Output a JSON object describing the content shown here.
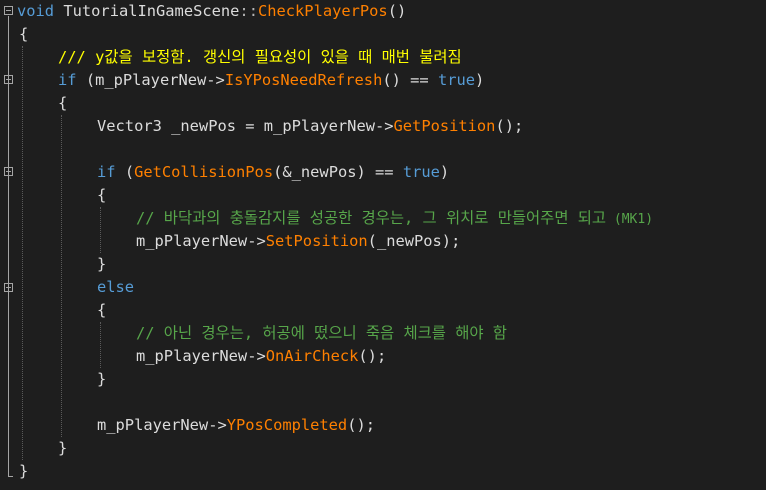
{
  "colors": {
    "background": "#1e1e1e",
    "keyword": "#569cd6",
    "function": "#ff8000",
    "plain": "#dcdcdc",
    "comment": "#57a64a",
    "doc_comment": "#ffff00",
    "fold_marker": "#a5a5a5"
  },
  "lines": {
    "l1": {
      "kw": "void",
      "name": "TutorialInGameScene",
      "sep": "::",
      "fn": "CheckPlayerPos",
      "tail": "()"
    },
    "l2": {
      "text": "{"
    },
    "l3": {
      "slashes": "///",
      "text": "y값을 보정함. 갱신의 필요성이 있을 때 매번 불려짐"
    },
    "l4": {
      "kw": "if",
      "pre": " (m_pPlayerNew->",
      "fn": "IsYPosNeedRefresh",
      "mid": "() == ",
      "kw2": "true",
      "tail": ")"
    },
    "l5": {
      "text": "{"
    },
    "l6": {
      "pre": "Vector3 _newPos = m_pPlayerNew->",
      "fn": "GetPosition",
      "tail": "();"
    },
    "l8": {
      "kw": "if",
      "pre": " (",
      "fn": "GetCollisionPos",
      "mid": "(&_newPos) == ",
      "kw2": "true",
      "tail": ")"
    },
    "l9": {
      "text": "{"
    },
    "l10": {
      "text": "// 바닥과의 충돌감지를 성공한 경우는, 그 위치로 만들어주면 되고",
      "tag": " (MK1)"
    },
    "l11": {
      "pre": "m_pPlayerNew->",
      "fn": "SetPosition",
      "tail": "(_newPos);"
    },
    "l12": {
      "text": "}"
    },
    "l13": {
      "kw": "else"
    },
    "l14": {
      "text": "{"
    },
    "l15": {
      "text": "// 아닌 경우는, 허공에 떴으니 죽음 체크를 해야 함"
    },
    "l16": {
      "pre": "m_pPlayerNew->",
      "fn": "OnAirCheck",
      "tail": "();"
    },
    "l17": {
      "text": "}"
    },
    "l19": {
      "pre": "m_pPlayerNew->",
      "fn": "YPosCompleted",
      "tail": "();"
    },
    "l20": {
      "text": "}"
    },
    "l21": {
      "text": "}"
    }
  }
}
